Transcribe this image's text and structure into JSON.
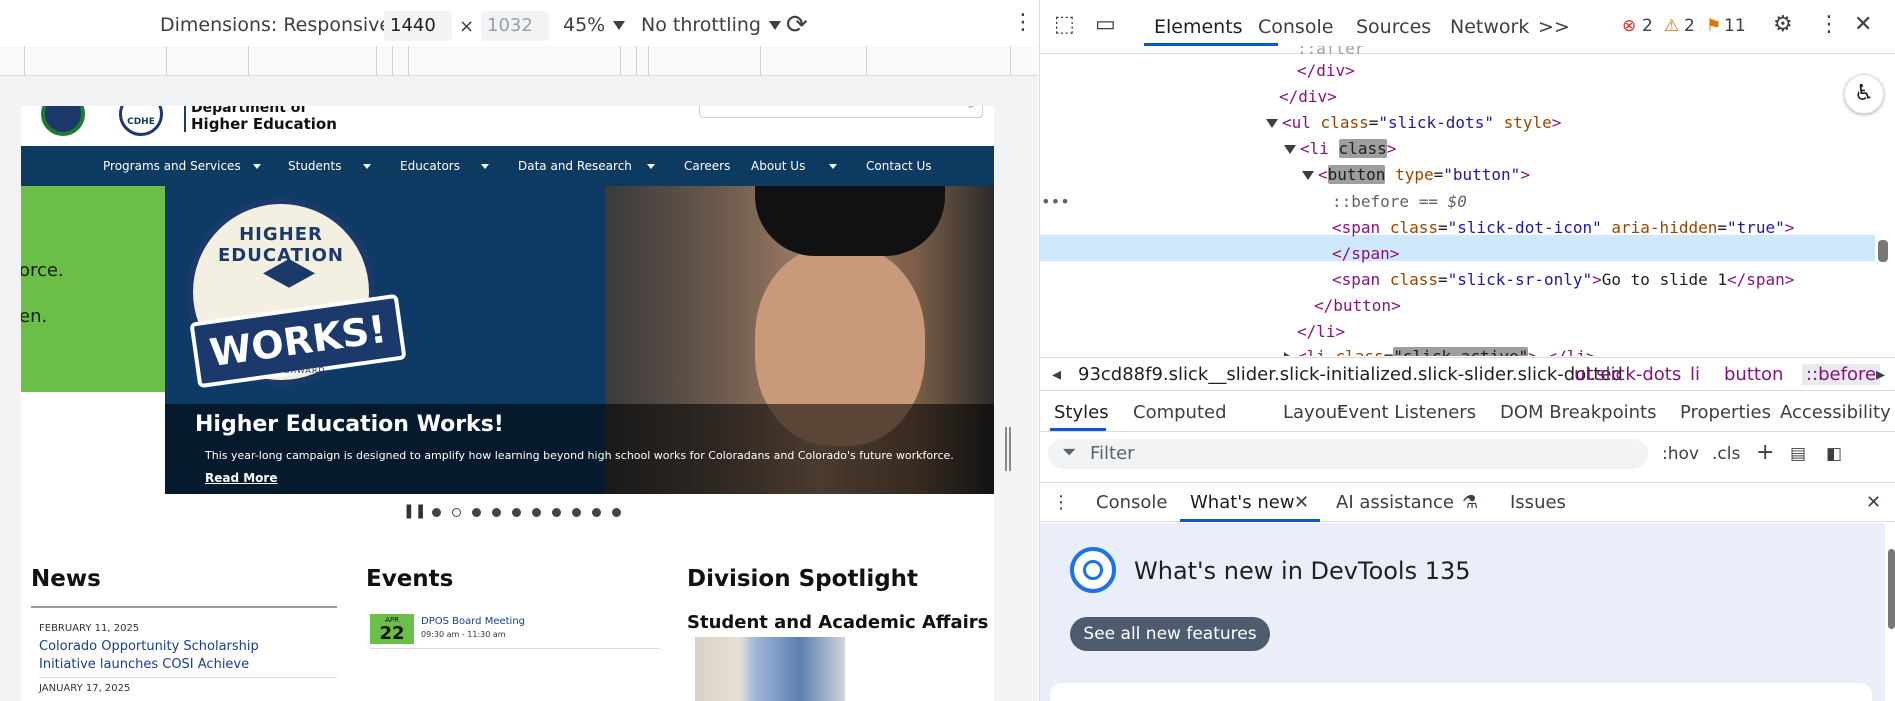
{
  "device_toolbar": {
    "dimensions_label": "Dimensions: Responsive",
    "width_value": "1440",
    "times": "×",
    "height_placeholder": "1032",
    "zoom": "45%",
    "throttling": "No throttling"
  },
  "site": {
    "dept_line1": "Department of",
    "dept_line2": "Higher Education",
    "logo_abbr": "CDHE",
    "nav": [
      "Programs and Services",
      "Students",
      "Educators",
      "Data and Research",
      "Careers",
      "About Us",
      "Contact Us"
    ],
    "green_panel_lines": [
      "orce.",
      "en."
    ],
    "badge_top": "HIGHER EDUCATION",
    "badge_main": "WORKS!",
    "badge_bottom": "FUTURE FORWARD",
    "hero_title": "Higher Education Works!",
    "hero_desc": "This year-long campaign is designed to amplify how learning beyond high school works for Coloradans and Colorado's future workforce.",
    "hero_read_more": "Read More",
    "slide_count": 10,
    "active_slide": 2,
    "news_title": "News",
    "news_date1": "FEBRUARY 11, 2025",
    "news_link1": "Colorado Opportunity Scholarship Initiative launches COSI Achieve",
    "news_date2": "JANUARY 17, 2025",
    "events_title": "Events",
    "event_month": "APR",
    "event_day": "22",
    "event_name": "DPOS Board Meeting",
    "event_time": "09:30 am - 11:30 am",
    "spotlight_title": "Division Spotlight",
    "spotlight_sub": "Student and Academic Affairs"
  },
  "devtools": {
    "tabs": [
      "Elements",
      "Console",
      "Sources",
      "Network"
    ],
    "more_tabs": ">>",
    "errors": "2",
    "warnings": "2",
    "issues": "11",
    "dom": {
      "after": "::after",
      "close_div1": "</div>",
      "close_div2": "</div>",
      "ul_open": "<ul",
      "ul_attr": "class",
      "ul_val": "\"slick-dots\"",
      "ul_attr2": "style",
      "li_open": "<li",
      "li_attr": "class",
      "button_tag": "button",
      "button_attr": "type",
      "button_val": "\"button\"",
      "before": "::before",
      "eq": "== $0",
      "span1_open": "<span",
      "span1_attr": "class",
      "span1_val": "\"slick-dot-icon\"",
      "span1_attr2": "aria-hidden",
      "span1_val2": "\"true\"",
      "span_close": "</span>",
      "span2_open": "<span",
      "span2_attr": "class",
      "span2_val": "\"slick-sr-only\"",
      "span2_text": "Go to slide 1",
      "button_close": "</button>",
      "li_close": "</li>",
      "li2_open": "<li",
      "li2_attr": "class",
      "li2_val": "\"slick-active\"",
      "li2_rest": "</li>"
    },
    "breadcrumb": [
      "93cd88f9.slick__slider.slick-initialized.slick-slider.slick-dotted",
      "ul.slick-dots",
      "li",
      "button",
      "::before"
    ],
    "subtabs": [
      "Styles",
      "Computed",
      "Layout",
      "Event Listeners",
      "DOM Breakpoints",
      "Properties",
      "Accessibility"
    ],
    "filter_placeholder": "Filter",
    "hov": ":hov",
    "cls": ".cls",
    "drawer_tabs": [
      "Console",
      "What's new",
      "AI assistance",
      "Issues"
    ],
    "whats_new_title": "What's new in DevTools 135",
    "see_all": "See all new features"
  }
}
